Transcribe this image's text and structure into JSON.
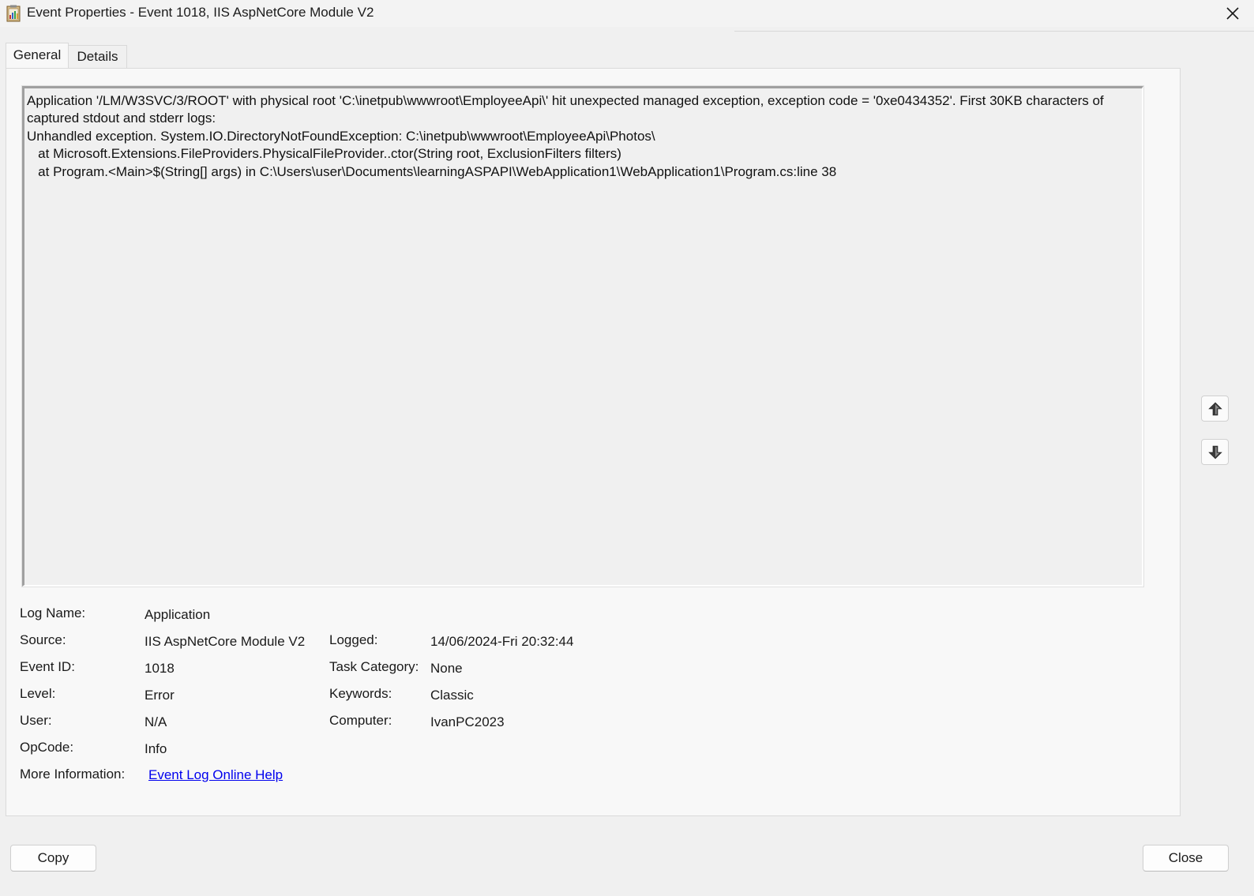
{
  "window": {
    "title": "Event Properties - Event 1018, IIS AspNetCore Module V2"
  },
  "tabs": [
    {
      "label": "General",
      "selected": true
    },
    {
      "label": "Details",
      "selected": false
    }
  ],
  "description": {
    "lines": [
      "Application '/LM/W3SVC/3/ROOT' with physical root 'C:\\inetpub\\wwwroot\\EmployeeApi\\' hit unexpected managed exception, exception code = '0xe0434352'. First 30KB characters of captured stdout and stderr logs:",
      "Unhandled exception. System.IO.DirectoryNotFoundException: C:\\inetpub\\wwwroot\\EmployeeApi\\Photos\\",
      "   at Microsoft.Extensions.FileProviders.PhysicalFileProvider..ctor(String root, ExclusionFilters filters)",
      "   at Program.<Main>$(String[] args) in C:\\Users\\user\\Documents\\learningASPAPI\\WebApplication1\\WebApplication1\\Program.cs:line 38"
    ]
  },
  "fields": {
    "log_name": {
      "label": "Log Name:",
      "value": "Application"
    },
    "source": {
      "label": "Source:",
      "value": "IIS AspNetCore Module V2"
    },
    "logged": {
      "label": "Logged:",
      "value": "14/06/2024-Fri 20:32:44"
    },
    "event_id": {
      "label": "Event ID:",
      "value": "1018"
    },
    "task_category": {
      "label": "Task Category:",
      "value": "None"
    },
    "level": {
      "label": "Level:",
      "value": "Error"
    },
    "keywords": {
      "label": "Keywords:",
      "value": "Classic"
    },
    "user": {
      "label": "User:",
      "value": "N/A"
    },
    "computer": {
      "label": "Computer:",
      "value": "IvanPC2023"
    },
    "opcode": {
      "label": "OpCode:",
      "value": "Info"
    },
    "more_info": {
      "label": "More Information:",
      "link_text": "Event Log Online Help"
    }
  },
  "buttons": {
    "copy": "Copy",
    "close": "Close"
  },
  "icons": {
    "app": "event-viewer-icon",
    "close": "close-icon",
    "up": "arrow-up-icon",
    "down": "arrow-down-icon"
  },
  "colors": {
    "link": "#0000ee",
    "background": "#f0f0f0"
  }
}
